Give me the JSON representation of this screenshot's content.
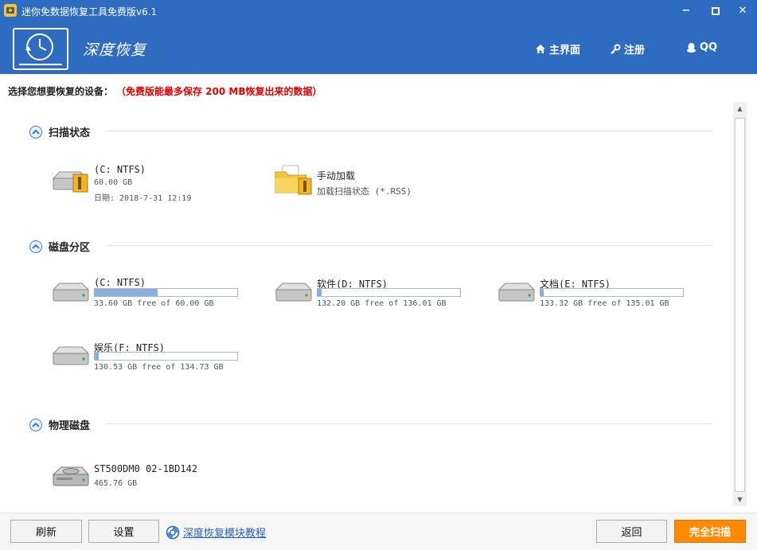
{
  "window": {
    "title": "迷你免数据恢复工具免费版v6.1",
    "minimize": "−",
    "maximize": "□",
    "close": "✕"
  },
  "banner": {
    "logo_text": "深度恢复",
    "nav": [
      {
        "label": "主界面",
        "icon": "home-icon"
      },
      {
        "label": "注册",
        "icon": "key-icon"
      },
      {
        "label": "QQ",
        "icon": "qq-penguin-icon"
      }
    ]
  },
  "notice": {
    "prefix": "选择您想要恢复的设备：",
    "warning": "（免费版能最多保存 200 MB恢复出来的数据）"
  },
  "sections": {
    "scan_state": {
      "title": "扫描状态",
      "items": [
        {
          "name": "(C: NTFS)",
          "size": "60.00 GB",
          "date": "日期: 2018-7-31 12:19"
        },
        {
          "name": "手动加载",
          "subtitle": "加载扫描状态 (*.RSS)"
        }
      ]
    },
    "partitions": {
      "title": "磁盘分区",
      "items": [
        {
          "name": "(C: NTFS)",
          "free_text": "33.60 GB free of 60.00 GB",
          "used_fraction": 0.44
        },
        {
          "name": "软件(D: NTFS)",
          "free_text": "132.20 GB free of 136.01 GB",
          "used_fraction": 0.028
        },
        {
          "name": "文档(E: NTFS)",
          "free_text": "133.32 GB free of 135.01 GB",
          "used_fraction": 0.0125
        },
        {
          "name": "娱乐(F: NTFS)",
          "free_text": "130.53 GB free of 134.73 GB",
          "used_fraction": 0.031
        }
      ]
    },
    "physical": {
      "title": "物理磁盘",
      "items": [
        {
          "name": "ST500DM0 02-1BD142",
          "size": "465.76 GB"
        }
      ]
    }
  },
  "bottom": {
    "refresh": "刷新",
    "settings": "设置",
    "tutorial": "深度恢复模块教程",
    "back": "返回",
    "full_scan": "完全扫描"
  },
  "colors": {
    "banner": "#2d6cc0",
    "accent": "#ff8a00",
    "warning": "#e00000",
    "bar_fill": "#8aaee0"
  }
}
